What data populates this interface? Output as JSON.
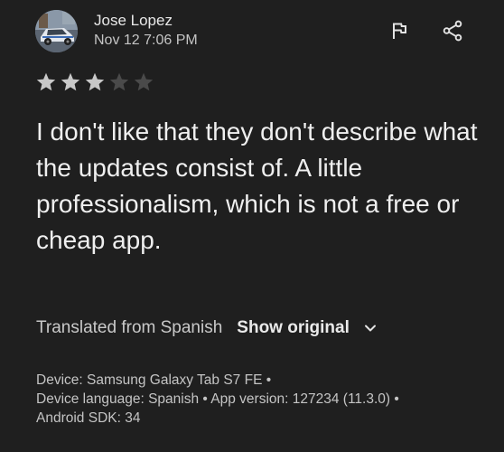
{
  "review": {
    "reviewer_name": "Jose Lopez",
    "date": "Nov 12 7:06 PM",
    "rating": 3,
    "max_rating": 5,
    "text": "I don't like that they don't describe what the updates consist of. A little professionalism, which is not a free or cheap app.",
    "avatar_icon": "car-photo-avatar"
  },
  "actions": {
    "flag_icon": "flag-icon",
    "share_icon": "share-icon"
  },
  "translation": {
    "label": "Translated from Spanish",
    "show_original": "Show original",
    "chevron_icon": "chevron-down-icon"
  },
  "device_info": {
    "device": "Device: Samsung Galaxy Tab S7 FE •",
    "language": "Device language: Spanish •",
    "app_version": "App version: 127234 (11.3.0) •",
    "sdk": "Android SDK: 34"
  },
  "colors": {
    "background": "#1f1f1f",
    "star_filled": "#c8c8c8",
    "star_empty": "#4a4a4a"
  }
}
